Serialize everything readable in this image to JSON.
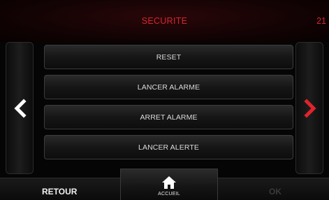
{
  "header": {
    "title": "SECURITE",
    "time": "21"
  },
  "menu": {
    "items": [
      {
        "label": "RESET"
      },
      {
        "label": "LANCER ALARME"
      },
      {
        "label": "ARRET ALARME"
      },
      {
        "label": "LANCER ALERTE"
      }
    ]
  },
  "nav": {
    "prev_icon": "chevron-left-icon",
    "next_icon": "chevron-right-icon",
    "prev_color": "#ffffff",
    "next_color": "#e0242c"
  },
  "bottom": {
    "back_label": "RETOUR",
    "home_label": "ACCUEIL",
    "home_icon": "home-icon",
    "ok_label": "OK"
  },
  "colors": {
    "accent": "#d4262e",
    "text": "#dcdcdc",
    "disabled": "#3a3a3a"
  }
}
